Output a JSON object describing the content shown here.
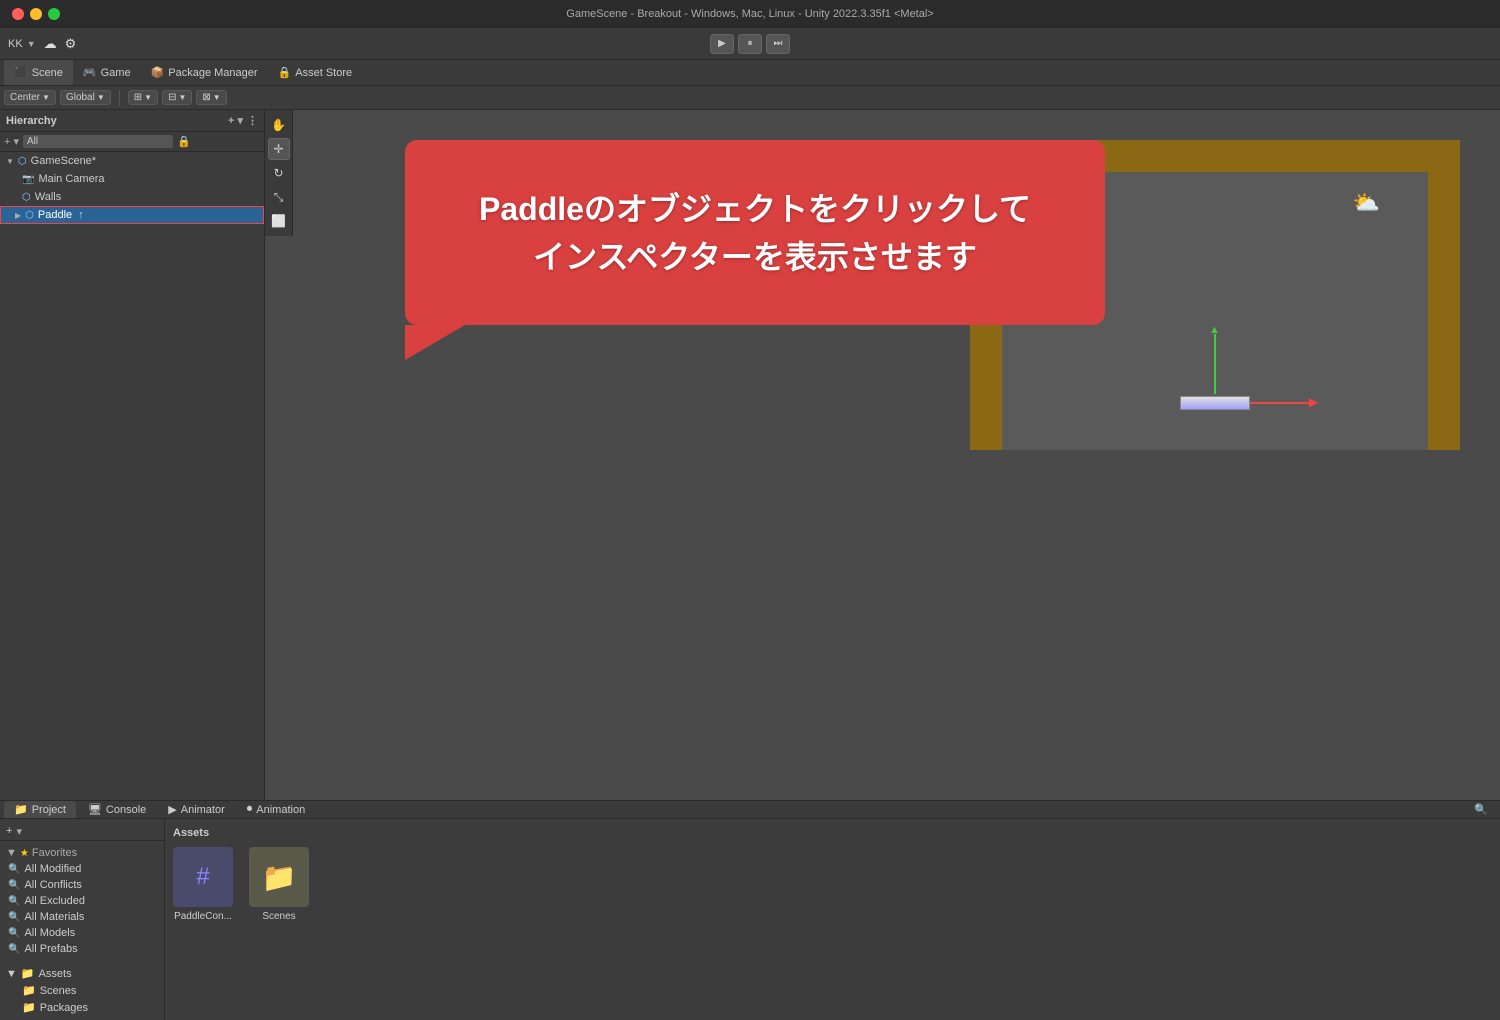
{
  "titlebar": {
    "title": "GameScene - Breakout - Windows, Mac, Linux - Unity 2022.3.35f1 <Metal>"
  },
  "toolbar": {
    "account": "KK",
    "cloud_label": "☁",
    "gear_label": "⚙"
  },
  "tabs": [
    {
      "label": "Scene",
      "icon": "⬛"
    },
    {
      "label": "Game",
      "icon": "🎮"
    },
    {
      "label": "Package Manager",
      "icon": "📦"
    },
    {
      "label": "Asset Store",
      "icon": "🔒"
    }
  ],
  "scene_toolbar": {
    "center_btn": "Center",
    "global_btn": "Global",
    "btn3": "⊞",
    "btn4": "⊟",
    "btn5": "⊠"
  },
  "hierarchy": {
    "title": "Hierarchy",
    "search_placeholder": "All",
    "items": [
      {
        "label": "GameScene*",
        "indent": 1,
        "type": "scene"
      },
      {
        "label": "Main Camera",
        "indent": 2,
        "type": "camera"
      },
      {
        "label": "Walls",
        "indent": 2,
        "type": "walls"
      },
      {
        "label": "Paddle",
        "indent": 2,
        "type": "paddle",
        "selected": true
      }
    ]
  },
  "callout": {
    "text_line1": "Paddleのオブジェクトをクリックして",
    "text_line2": "インスペクターを表示させます"
  },
  "bottom_panel": {
    "tabs": [
      {
        "label": "Project",
        "icon": "📁"
      },
      {
        "label": "Console",
        "icon": "🖥"
      },
      {
        "label": "Animator",
        "icon": "▶"
      },
      {
        "label": "Animation",
        "icon": "⏺"
      }
    ],
    "add_btn": "+",
    "assets_title": "Assets",
    "favorites": {
      "label": "Favorites",
      "items": [
        "All Modified",
        "All Conflicts",
        "All Excluded",
        "All Materials",
        "All Models",
        "All Prefabs"
      ]
    },
    "file_tree": {
      "assets_label": "Assets",
      "items": [
        {
          "label": "Scenes",
          "indent": 1
        },
        {
          "label": "Packages",
          "indent": 1
        }
      ]
    },
    "assets": [
      {
        "label": "PaddleCon...",
        "type": "script"
      },
      {
        "label": "Scenes",
        "type": "folder"
      }
    ]
  },
  "play_controls": {
    "play": "▶",
    "pause": "⏸",
    "step": "⏭"
  }
}
